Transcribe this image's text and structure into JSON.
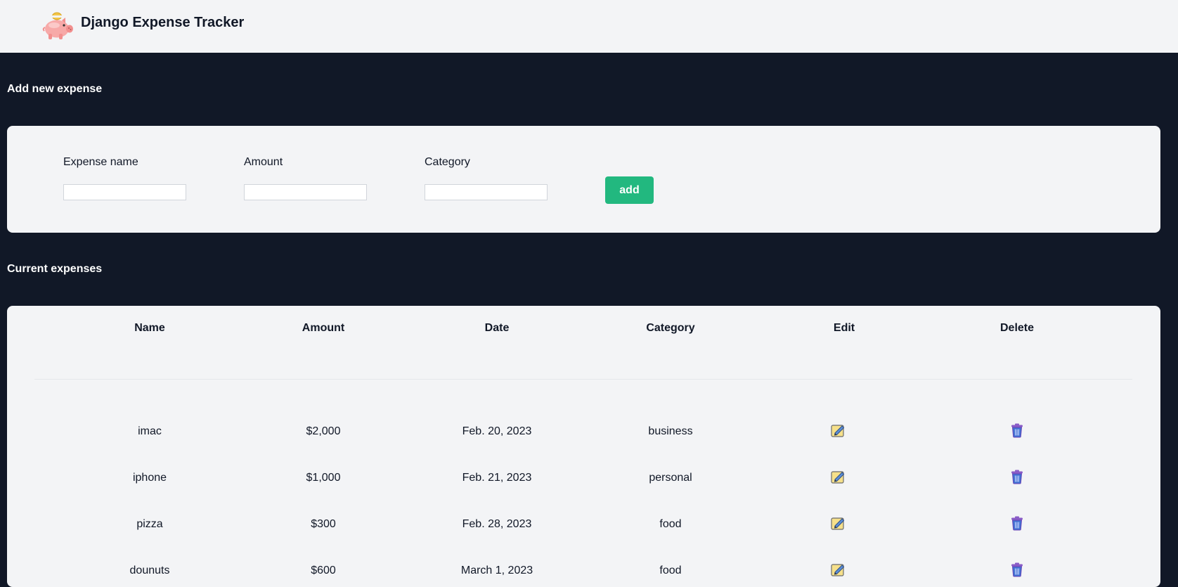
{
  "app": {
    "title": "Django Expense Tracker",
    "logo_icon": "piggy-bank-icon"
  },
  "add_form": {
    "heading": "Add new expense",
    "fields": [
      {
        "label": "Expense name",
        "value": "",
        "placeholder": ""
      },
      {
        "label": "Amount",
        "value": "",
        "placeholder": ""
      },
      {
        "label": "Category",
        "value": "",
        "placeholder": ""
      }
    ],
    "submit_label": "add"
  },
  "expenses": {
    "heading": "Current expenses",
    "columns": [
      "Name",
      "Amount",
      "Date",
      "Category",
      "Edit",
      "Delete"
    ],
    "rows": [
      {
        "name": "imac",
        "amount": "$2,000",
        "date": "Feb. 20, 2023",
        "category": "business"
      },
      {
        "name": "iphone",
        "amount": "$1,000",
        "date": "Feb. 21, 2023",
        "category": "personal"
      },
      {
        "name": "pizza",
        "amount": "$300",
        "date": "Feb. 28, 2023",
        "category": "food"
      },
      {
        "name": "dounuts",
        "amount": "$600",
        "date": "March 1, 2023",
        "category": "food"
      }
    ],
    "edit_icon": "pencil-memo-icon",
    "delete_icon": "trash-can-icon"
  },
  "colors": {
    "page_background": "#111827",
    "card_background": "#f3f4f6",
    "accent": "#22b87f"
  }
}
